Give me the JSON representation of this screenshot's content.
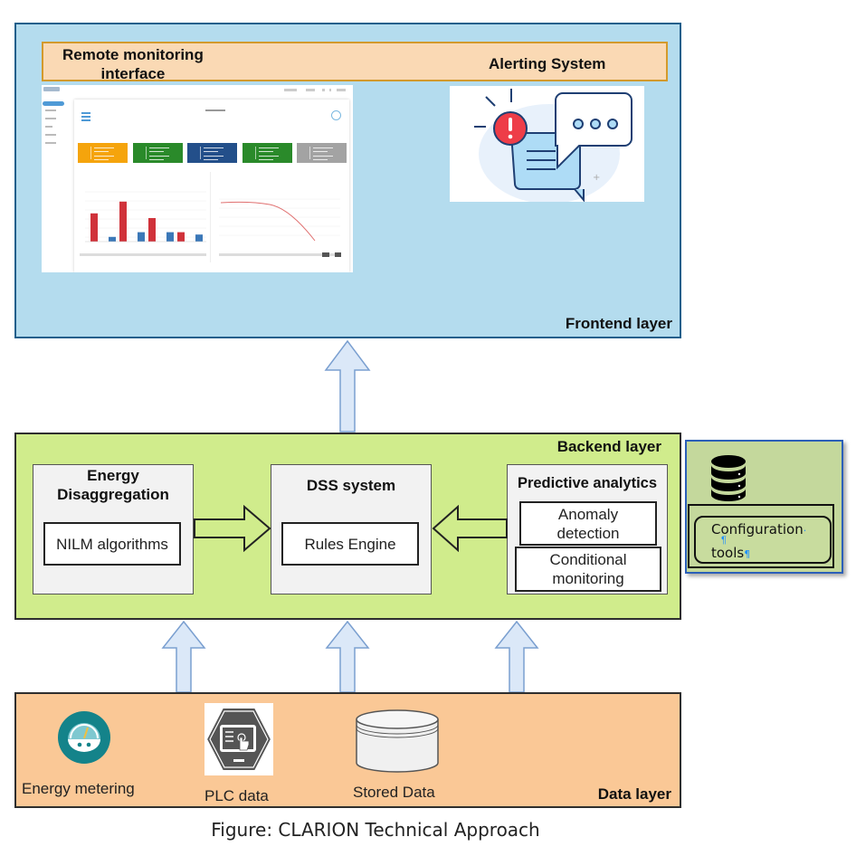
{
  "frontend": {
    "layer_label": "Frontend layer",
    "banner": {
      "remote_monitoring_line1": "Remote monitoring",
      "remote_monitoring_line2": "interface",
      "alerting_system": "Alerting System"
    },
    "dashboard_kpi_colors": [
      "#f5a40c",
      "#2a8a2a",
      "#234f8a",
      "#2a8a2a",
      "#a3a3a3"
    ],
    "dashboard_bar_values": [
      0.6,
      0.1,
      0.85,
      0.2,
      0.5,
      0.2,
      0.2,
      0.15
    ],
    "alert_icon": "alert-chat-icon"
  },
  "backend": {
    "layer_label": "Backend layer",
    "energy_disaggregation": {
      "title_line1": "Energy",
      "title_line2": "Disaggregation",
      "component": "NILM algorithms"
    },
    "dss": {
      "title": "DSS system",
      "component": "Rules Engine"
    },
    "predictive": {
      "title": "Predictive analytics",
      "component1_line1": "Anomaly",
      "component1_line2": "detection",
      "component2_line1": "Conditional",
      "component2_line2": "monitoring"
    }
  },
  "config_tools": {
    "icon": "database-icon",
    "line1": "Configuration",
    "line2": "tools",
    "pilcrow": "¶",
    "dot": "·"
  },
  "data_layer": {
    "layer_label": "Data layer",
    "sources": [
      {
        "label": "Energy metering",
        "icon": "gauge-icon"
      },
      {
        "label": "PLC data",
        "icon": "hmi-touch-icon"
      },
      {
        "label": "Stored Data",
        "icon": "storage-cylinder-icon"
      }
    ]
  },
  "caption": "Figure: CLARION Technical Approach"
}
